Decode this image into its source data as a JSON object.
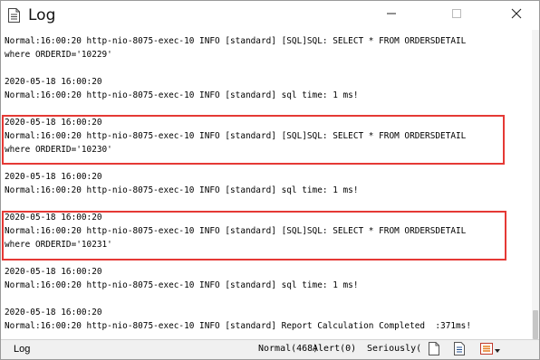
{
  "window": {
    "title": "Log"
  },
  "log": {
    "lines": [
      "2020-05-18 16:00:20",
      "Normal:16:00:20 http-nio-8075-exec-10 INFO [standard] [SQL]SQL: SELECT * FROM ORDERSDETAIL",
      "where ORDERID='10229'",
      "",
      "2020-05-18 16:00:20",
      "Normal:16:00:20 http-nio-8075-exec-10 INFO [standard] sql time: 1 ms!",
      "",
      "2020-05-18 16:00:20",
      "Normal:16:00:20 http-nio-8075-exec-10 INFO [standard] [SQL]SQL: SELECT * FROM ORDERSDETAIL",
      "where ORDERID='10230'",
      "",
      "2020-05-18 16:00:20",
      "Normal:16:00:20 http-nio-8075-exec-10 INFO [standard] sql time: 1 ms!",
      "",
      "2020-05-18 16:00:20",
      "Normal:16:00:20 http-nio-8075-exec-10 INFO [standard] [SQL]SQL: SELECT * FROM ORDERSDETAIL",
      "where ORDERID='10231'",
      "",
      "2020-05-18 16:00:20",
      "Normal:16:00:20 http-nio-8075-exec-10 INFO [standard] sql time: 1 ms!",
      "",
      "2020-05-18 16:00:20",
      "Normal:16:00:20 http-nio-8075-exec-10 INFO [standard] Report Calculation Completed  :371ms!"
    ]
  },
  "status": {
    "label": "Log",
    "normal": "Normal(468)",
    "alert": "Alert(0)",
    "serious": "Seriously("
  },
  "colors": {
    "highlight": "#e53935"
  }
}
